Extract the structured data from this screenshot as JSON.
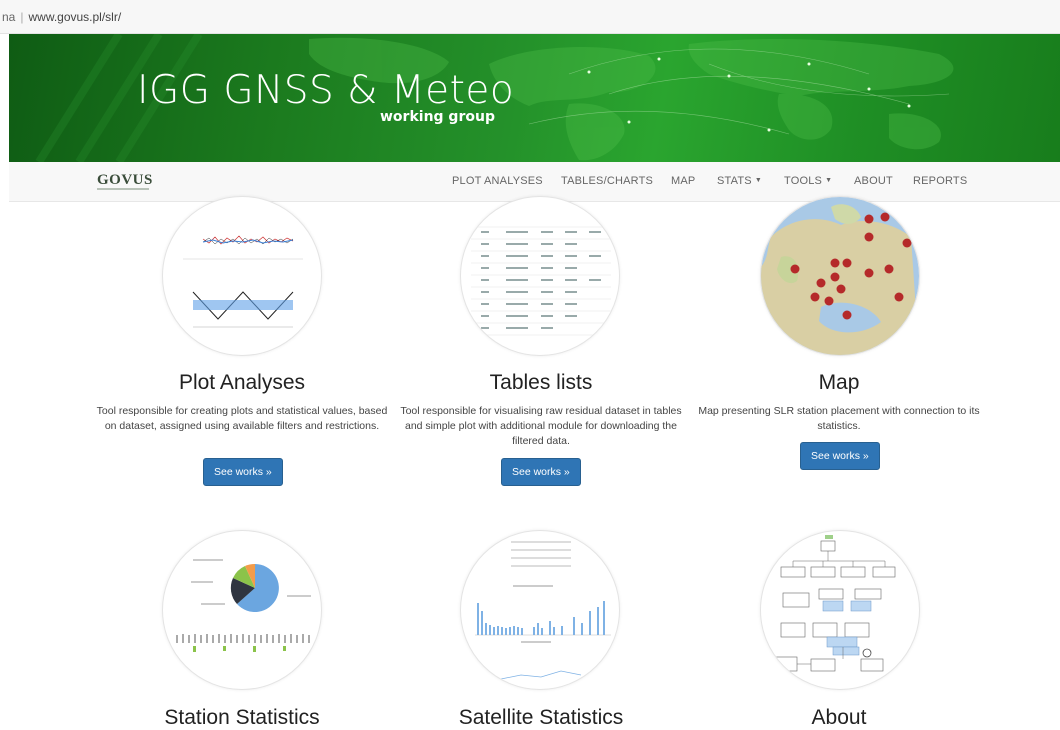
{
  "browser": {
    "tab_clip": "na",
    "url": "www.govus.pl/slr/"
  },
  "banner": {
    "title": "IGG GNSS & Meteo",
    "subtitle": "working group"
  },
  "navbar": {
    "brand": "GOVUS",
    "items": [
      {
        "label": "PLOT ANALYSES"
      },
      {
        "label": "TABLES/CHARTS"
      },
      {
        "label": "MAP"
      },
      {
        "label": "STATS",
        "dropdown": true
      },
      {
        "label": "TOOLS",
        "dropdown": true
      },
      {
        "label": "ABOUT"
      },
      {
        "label": "REPORTS"
      }
    ],
    "caret": "▼"
  },
  "cards": [
    {
      "title": "Plot Analyses",
      "description": "Tool responsible for creating plots and statistical values, based on dataset, assigned using available filters and restrictions.",
      "button": "See works »"
    },
    {
      "title": "Tables lists",
      "description": "Tool responsible for visualising raw residual dataset in tables and simple plot with additional module for downloading the filtered data.",
      "button": "See works »"
    },
    {
      "title": "Map",
      "description": "Map presenting SLR station placement with connection to its statistics.",
      "button": "See works »"
    },
    {
      "title": "Station Statistics"
    },
    {
      "title": "Satellite Statistics"
    },
    {
      "title": "About"
    }
  ],
  "colors": {
    "banner_green": "#1f8f25",
    "button_blue": "#2f75b5",
    "map_pin": "#b52a2a"
  }
}
